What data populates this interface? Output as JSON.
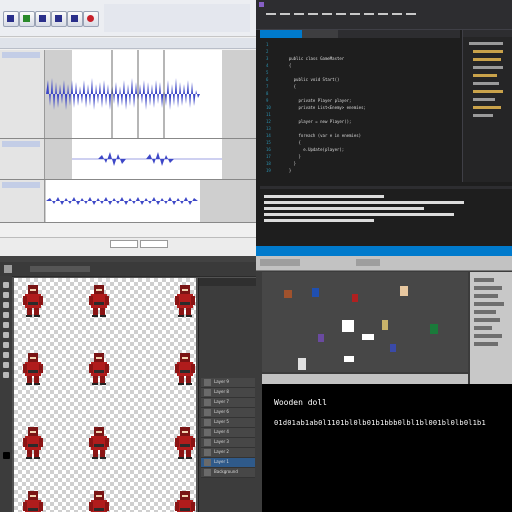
{
  "audacity": {
    "tracks": [
      {
        "name": "Audio Track 1",
        "clip_color": "#3d47c7"
      },
      {
        "name": "Audio Track 2",
        "clip_color": "#3d47c7"
      },
      {
        "name": "Audio Track 3",
        "clip_color": "#3d47c7"
      }
    ],
    "accent": "#3d47c7"
  },
  "visual_studio": {
    "accent": "#007acc",
    "code_lines": [
      "",
      "",
      "  public class GameMaster",
      "  {",
      "",
      "    public void Start()",
      "    {",
      "",
      "      private Player player;",
      "      private List<Enemy> enemies;",
      "",
      "      player = new Player();",
      "",
      "      foreach (var e in enemies)",
      "      {",
      "        e.Update(player);",
      "      }",
      "    }",
      "  }"
    ]
  },
  "photoshop": {
    "layers": [
      "Layer 9",
      "Layer 8",
      "Layer 7",
      "Layer 6",
      "Layer 5",
      "Layer 4",
      "Layer 3",
      "Layer 2",
      "Layer 1",
      "Background"
    ]
  },
  "unity": {
    "console_title": "Wooden doll",
    "console_bits": "01d01ab1ab0l1101bl0lb01b1bbb0lbl1bl001bl0lb0l1b1"
  }
}
